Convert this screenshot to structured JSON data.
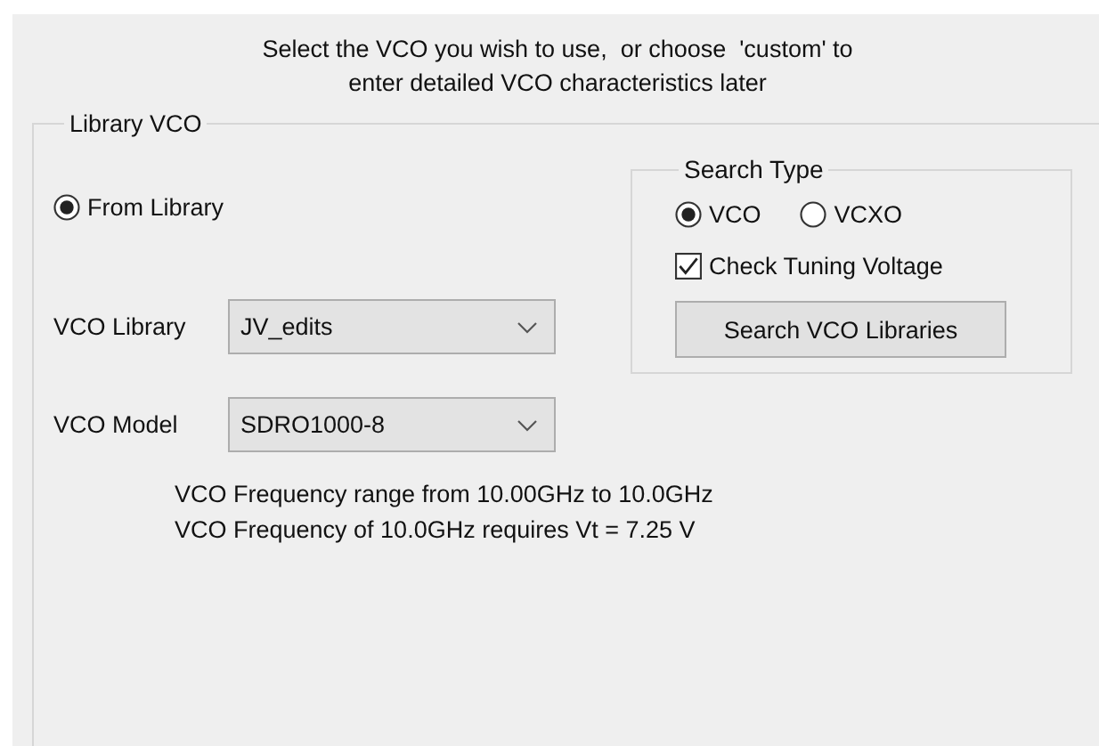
{
  "header": {
    "lines": [
      "Select the VCO you wish to use,  or choose  'custom' to",
      "enter detailed VCO characteristics later"
    ]
  },
  "library_group": {
    "title": "Library VCO",
    "source_options": [
      {
        "label": "From Library",
        "selected": true
      }
    ],
    "fields": [
      {
        "label": "VCO Library",
        "value": "JV_edits"
      },
      {
        "label": "VCO Model",
        "value": "SDRO1000-8"
      }
    ],
    "info_lines": [
      "VCO Frequency range from 10.00GHz to 10.0GHz",
      "VCO Frequency of 10.0GHz requires Vt = 7.25 V"
    ]
  },
  "search_type": {
    "title": "Search Type",
    "options": [
      {
        "label": "VCO",
        "selected": true
      },
      {
        "label": "VCXO",
        "selected": false
      }
    ],
    "check": {
      "label": "Check Tuning Voltage",
      "checked": true
    },
    "button": "Search VCO Libraries"
  }
}
